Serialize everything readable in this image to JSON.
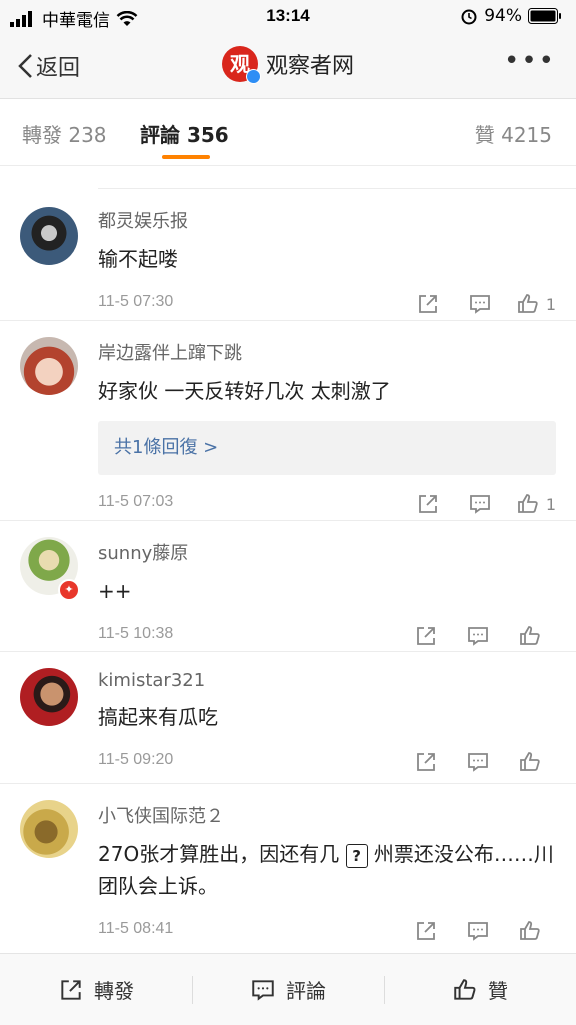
{
  "status": {
    "carrier": "中華電信",
    "time": "13:14",
    "battery": "94%"
  },
  "nav": {
    "back": "返回",
    "title": "观察者网",
    "more": "•••",
    "logo_char": "观"
  },
  "tabs": {
    "repost": "轉發 238",
    "comment": "評論 356",
    "like": "贊 4215"
  },
  "comments": [
    {
      "user": "都灵娱乐报",
      "text": "输不起喽",
      "time": "11-5 07:30",
      "likes": "1",
      "reply": null
    },
    {
      "user": "岸边露伴上蹿下跳",
      "text": "好家伙 一天反转好几次 太刺激了",
      "time": "11-5 07:03",
      "likes": "1",
      "reply": "共1條回復 >"
    },
    {
      "user": "sunny藤原",
      "text": "++",
      "time": "11-5 10:38",
      "likes": "",
      "reply": null
    },
    {
      "user": "kimistar321",
      "text": "搞起来有瓜吃",
      "time": "11-5 09:20",
      "likes": "",
      "reply": null
    },
    {
      "user": "小飞侠国际范２",
      "text_before": "27O张才算胜出，因还有几 ",
      "text_after": " 州票还没公布……川团队会上诉。",
      "missing_glyph": "?",
      "time": "11-5 08:41",
      "likes": "",
      "reply": null
    }
  ],
  "bottom": {
    "repost": "轉發",
    "comment": "評論",
    "like": "贊"
  },
  "colors": {
    "accent": "#ff8200",
    "link": "#4a72a6",
    "logo": "#d9261c"
  }
}
